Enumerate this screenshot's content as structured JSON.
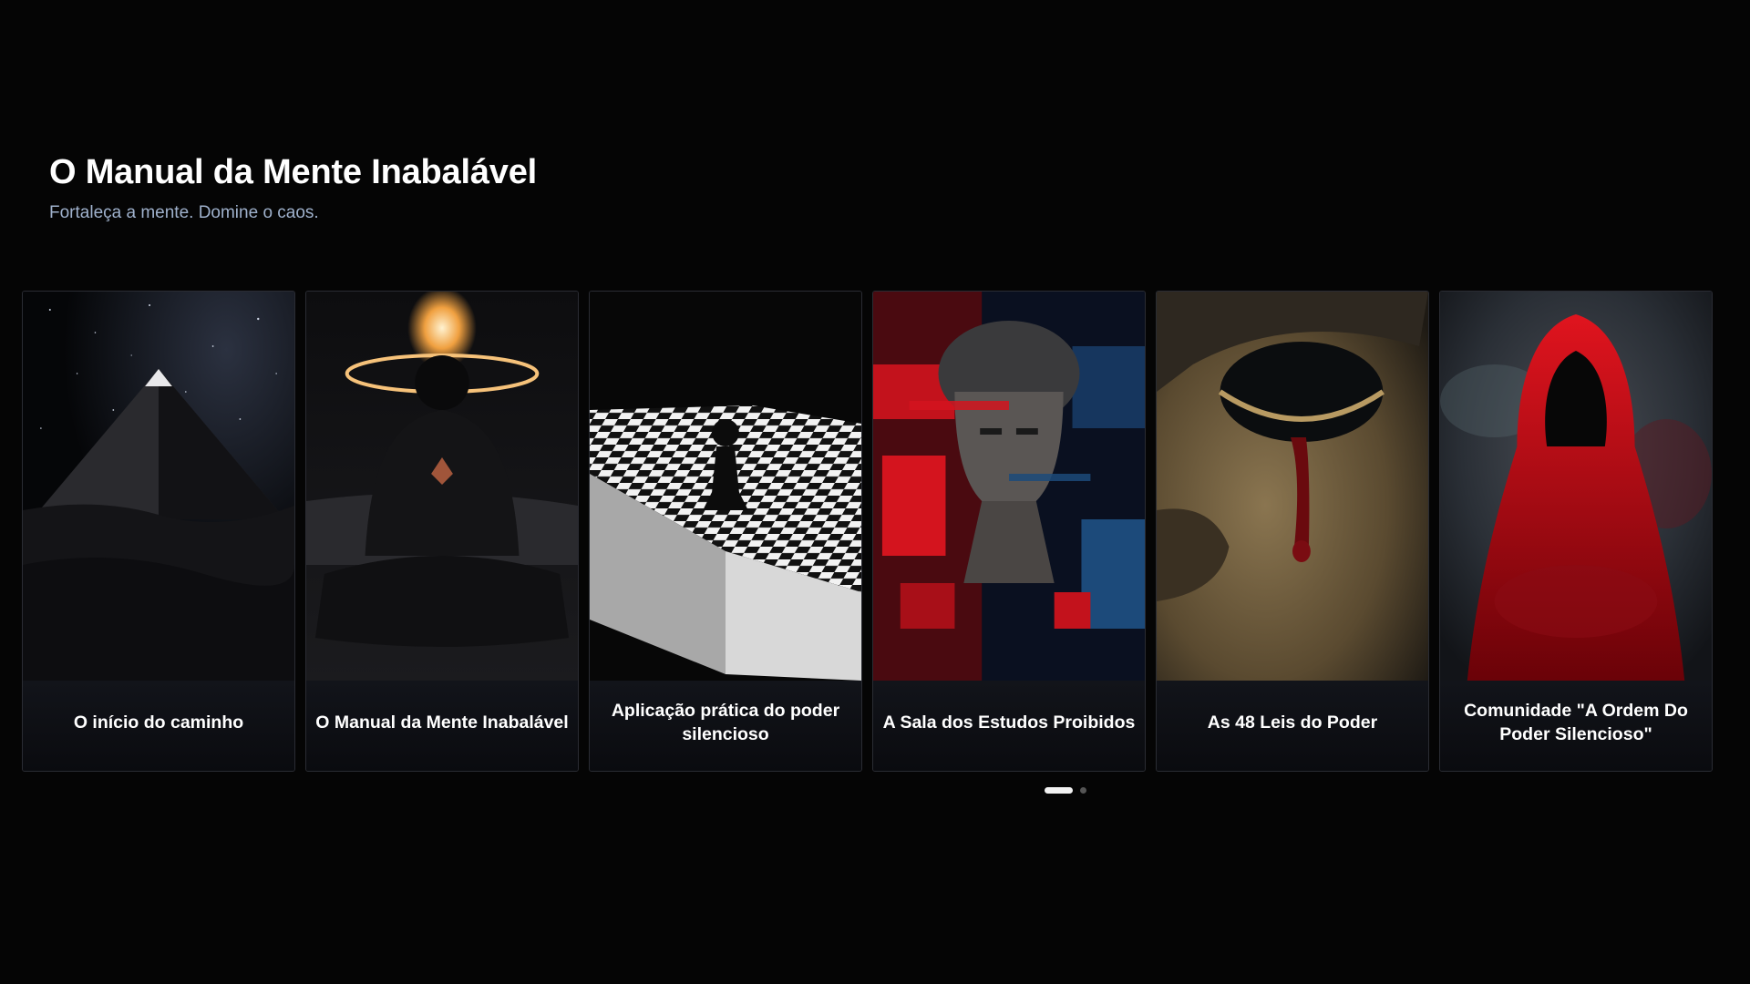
{
  "header": {
    "title": "O Manual da Mente Inabalável",
    "subtitle": "Fortaleça a mente. Domine o caos."
  },
  "cards": [
    {
      "label": "O início do caminho",
      "image": "pyramid-under-stars"
    },
    {
      "label": "O Manual da Mente Inabalável",
      "image": "meditating-figure-with-flame-halo"
    },
    {
      "label": "Aplicação prática do poder silencioso",
      "image": "chess-pawn-on-board"
    },
    {
      "label": "A Sala dos Estudos Proibidos",
      "image": "glitched-statue-bust"
    },
    {
      "label": "As 48 Leis do Poder",
      "image": "golden-mask-with-blood-tear"
    },
    {
      "label": "Comunidade \"A Ordem Do Poder Silencioso\"",
      "image": "red-hooded-figure-in-smoke"
    }
  ],
  "pagination": {
    "pages": 2,
    "current": 1
  },
  "colors": {
    "background": "#050505",
    "subtitle": "#9fb1cc",
    "accent_red": "#d0101a"
  }
}
